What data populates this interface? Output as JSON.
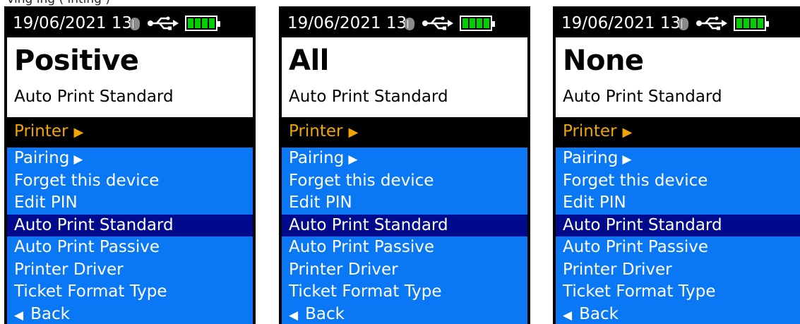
{
  "caption_fragment": "ving  ing   (  inting     )",
  "screens": [
    {
      "status": {
        "clock": "19/06/2021  13:"
      },
      "title": "Positive",
      "subtitle": "Auto Print Standard",
      "menu_header": "Printer",
      "items": [
        "Pairing",
        "Forget this device",
        "Edit PIN",
        "Auto Print Standard",
        "Auto Print Passive",
        "Printer Driver",
        "Ticket Format Type",
        "Back"
      ]
    },
    {
      "status": {
        "clock": "19/06/2021  13:"
      },
      "title": "All",
      "subtitle": "Auto Print Standard",
      "menu_header": "Printer",
      "items": [
        "Pairing",
        "Forget this device",
        "Edit PIN",
        "Auto Print Standard",
        "Auto Print Passive",
        "Printer Driver",
        "Ticket Format Type",
        "Back"
      ]
    },
    {
      "status": {
        "clock": "19/06/2021  13:"
      },
      "title": "None",
      "subtitle": "Auto Print Standard",
      "menu_header": "Printer",
      "items": [
        "Pairing",
        "Forget this device",
        "Edit PIN",
        "Auto Print Standard",
        "Auto Print Passive",
        "Printer Driver",
        "Ticket Format Type",
        "Back"
      ]
    }
  ],
  "colors": {
    "menu_bg": "#0a78f5",
    "selected_bg": "#000a8c",
    "header_text": "#f0a500",
    "battery": "#00d000"
  },
  "selected_index": 3,
  "icons": [
    "bluetooth-icon",
    "usb-icon",
    "battery-icon",
    "right-triangle-icon",
    "left-triangle-icon"
  ]
}
